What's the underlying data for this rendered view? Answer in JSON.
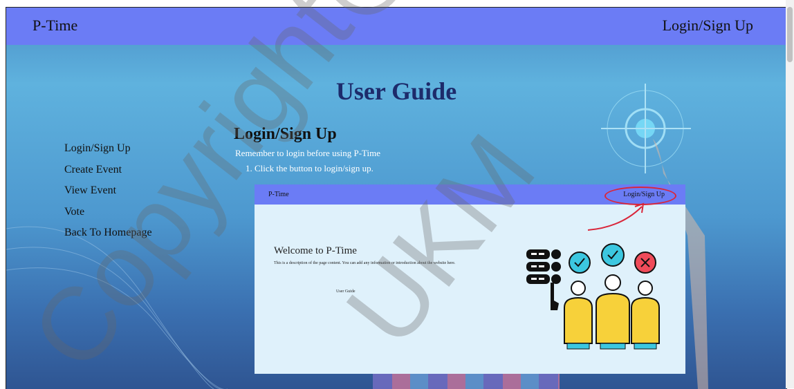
{
  "header": {
    "brand": "P-Time",
    "login": "Login/Sign Up"
  },
  "page_title": "User Guide",
  "sidebar": {
    "items": [
      {
        "label": "Login/Sign Up"
      },
      {
        "label": "Create Event"
      },
      {
        "label": "View Event"
      },
      {
        "label": "Vote"
      },
      {
        "label": "Back To Homepage"
      }
    ]
  },
  "section": {
    "title": "Login/Sign Up",
    "intro": "Remember to login before using P-Time",
    "step1": "1. Click the button to login/sign up."
  },
  "screenshot": {
    "brand": "P-Time",
    "login": "Login/Sign Up",
    "welcome": "Welcome to P-Time",
    "description": "This is a description of the page content. You can add any information or introduction about the website here.",
    "guide_link": "User Guide"
  },
  "watermark": {
    "line1": "Copyright@",
    "line2": "UKM"
  },
  "colors": {
    "header": "#6b7cf5",
    "title": "#1d2b6b",
    "highlight": "#d9263a"
  }
}
